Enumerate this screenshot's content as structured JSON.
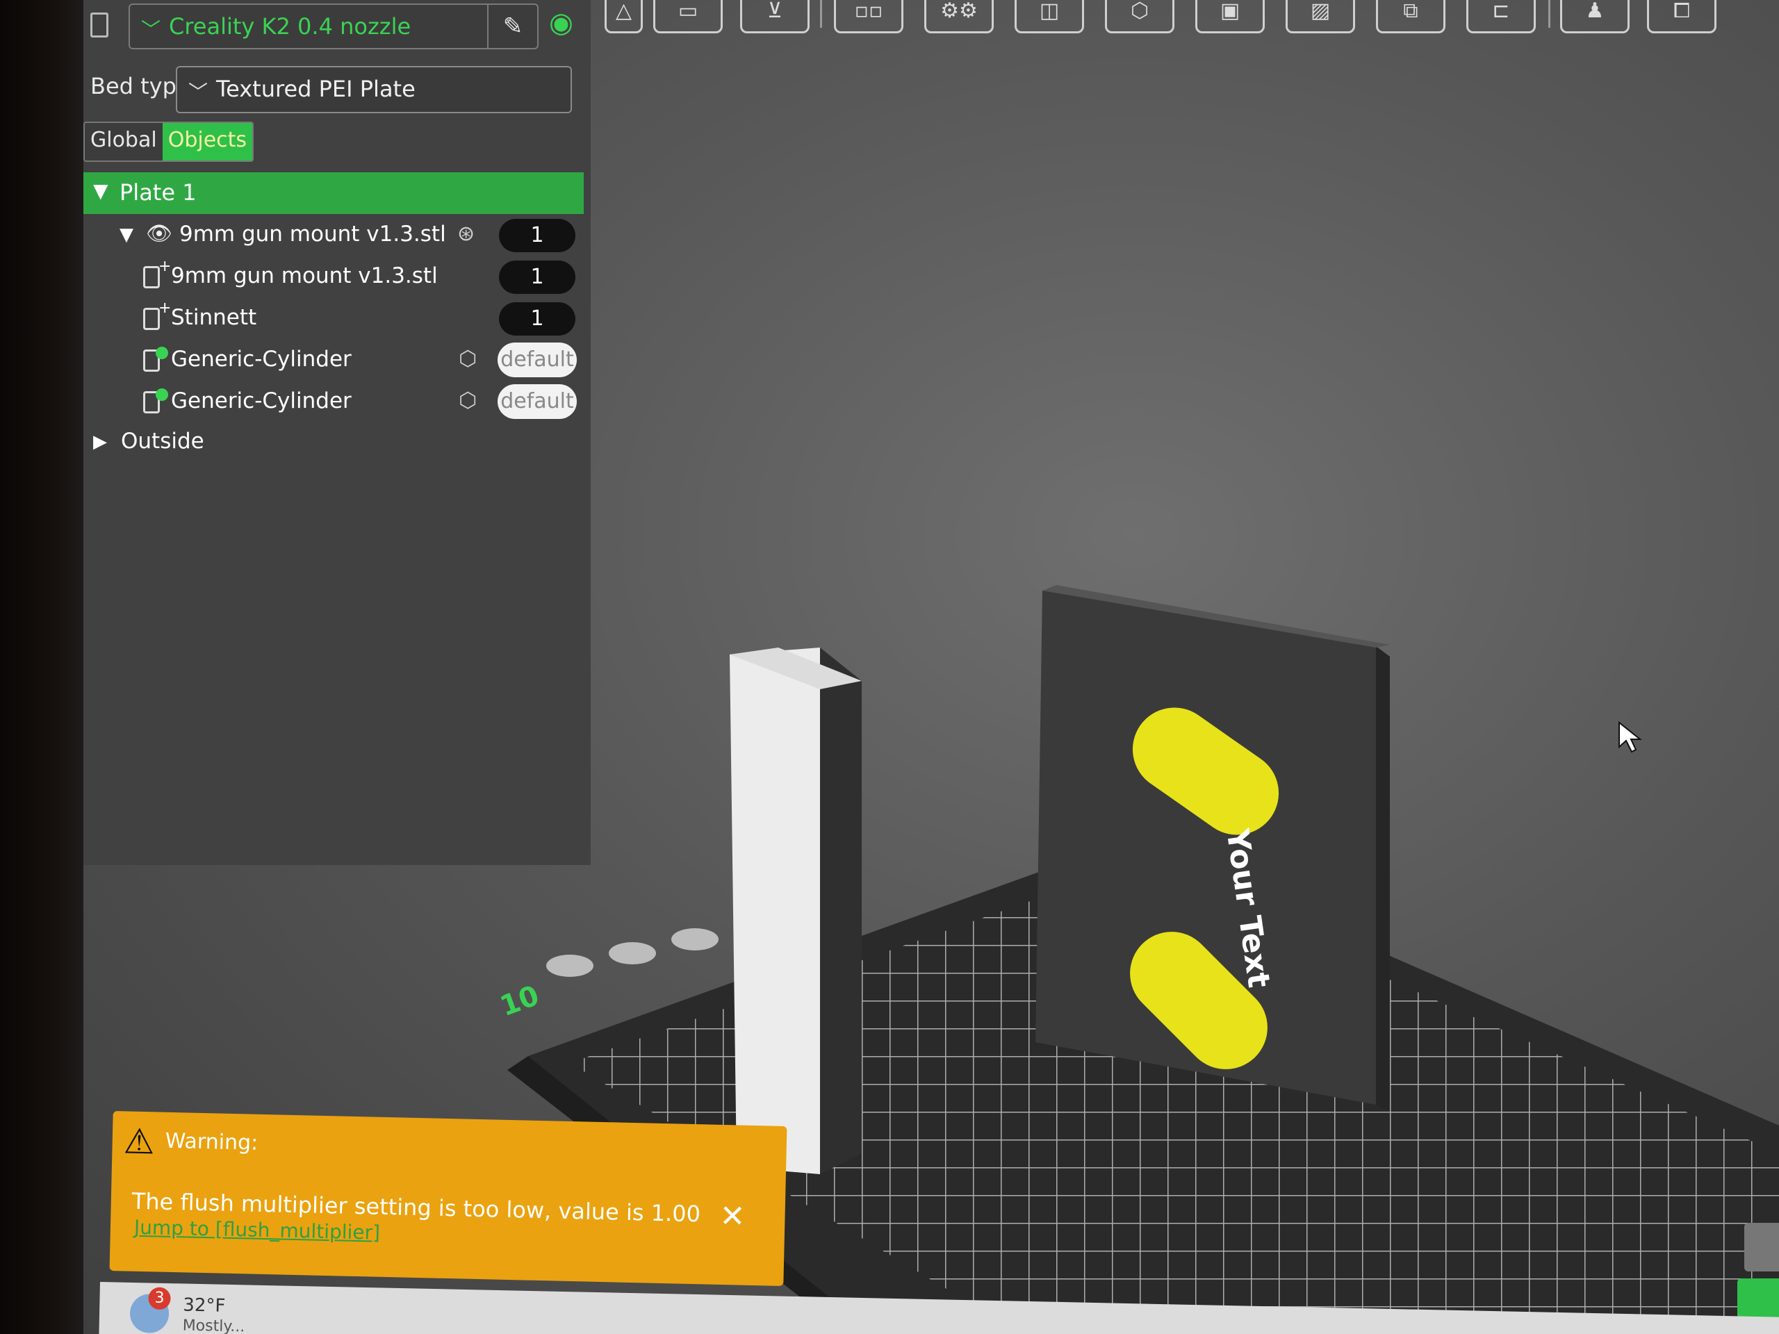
{
  "printer": {
    "name": "Creality K2 0.4 nozzle",
    "edit_icon": "pencil-icon",
    "wifi_icon": "wifi-icon"
  },
  "bed": {
    "label": "Bed type",
    "value": "Textured PEI Plate"
  },
  "tabs": [
    {
      "label": "Global"
    },
    {
      "label": "Objects",
      "active": true
    }
  ],
  "tree": {
    "plate": "Plate 1",
    "items": [
      {
        "name": "9mm gun mount v1.3.stl",
        "value": "1",
        "kind": "parent"
      },
      {
        "name": "9mm gun mount v1.3.stl",
        "value": "1",
        "kind": "part"
      },
      {
        "name": "Stinnett",
        "value": "1",
        "kind": "part"
      },
      {
        "name": "Generic-Cylinder",
        "value": "default",
        "kind": "modifier"
      },
      {
        "name": "Generic-Cylinder",
        "value": "default",
        "kind": "modifier"
      }
    ],
    "outside": "Outside"
  },
  "scene": {
    "plate_text": "Your Text",
    "axis_label": "10",
    "object_color": "#e8e21a"
  },
  "warning": {
    "title": "Warning:",
    "message": "The flush multiplier setting is too low, value is 1.00",
    "link": "Jump to [flush_multiplier]",
    "close": "✕"
  },
  "taskbar": {
    "badge": "3",
    "temperature": "32°F",
    "condition": "Mostly..."
  },
  "colors": {
    "accent": "#2fc04a",
    "panel": "#414141",
    "warning": "#eaa210"
  }
}
